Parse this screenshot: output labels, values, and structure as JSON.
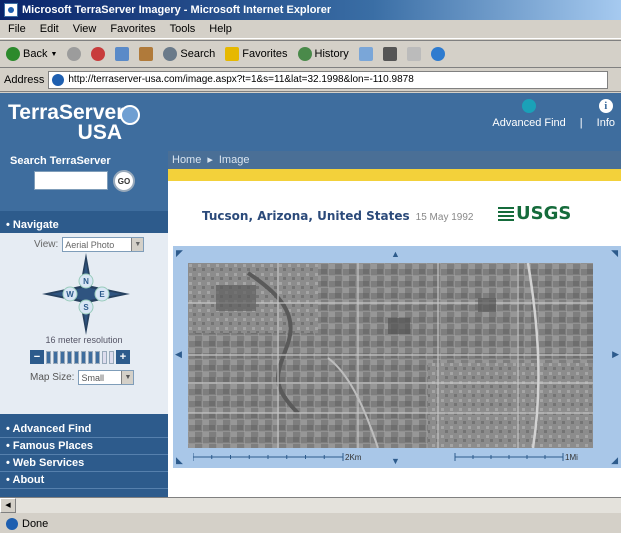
{
  "window": {
    "title": "Microsoft TerraServer Imagery - Microsoft Internet Explorer"
  },
  "menu": [
    "File",
    "Edit",
    "View",
    "Favorites",
    "Tools",
    "Help"
  ],
  "toolbar": {
    "back": "Back",
    "search": "Search",
    "favorites": "Favorites",
    "history": "History"
  },
  "address": {
    "label": "Address",
    "url": "http://terraserver-usa.com/image.aspx?t=1&s=11&lat=32.1998&lon=-110.9878"
  },
  "header": {
    "brand_line1": "TerraServer",
    "brand_line2": "USA",
    "advanced_find": "Advanced Find",
    "info": "Info",
    "info_glyph": "i"
  },
  "sidebar": {
    "search_title": "Search TerraServer",
    "search_value": "",
    "go_label": "GO",
    "navigate": "Navigate",
    "view_label": "View:",
    "view_value": "Aerial Photo",
    "compass": {
      "n": "N",
      "e": "E",
      "s": "S",
      "w": "W"
    },
    "resolution": "16 meter resolution",
    "zoom_minus": "−",
    "zoom_plus": "+",
    "zoom_levels": 10,
    "zoom_level": 8,
    "map_size_label": "Map Size:",
    "map_size_value": "Small",
    "menu": [
      "Advanced Find",
      "Famous Places",
      "Web Services",
      "About"
    ]
  },
  "content": {
    "breadcrumb": [
      "Home",
      "Image"
    ],
    "breadcrumb_sep": "▸",
    "place": "Tucson, Arizona, United States",
    "date": "15 May 1992",
    "usgs": "USGS",
    "scale_km": "2Km",
    "scale_mi": "1Mi"
  },
  "status": {
    "text": "Done"
  }
}
